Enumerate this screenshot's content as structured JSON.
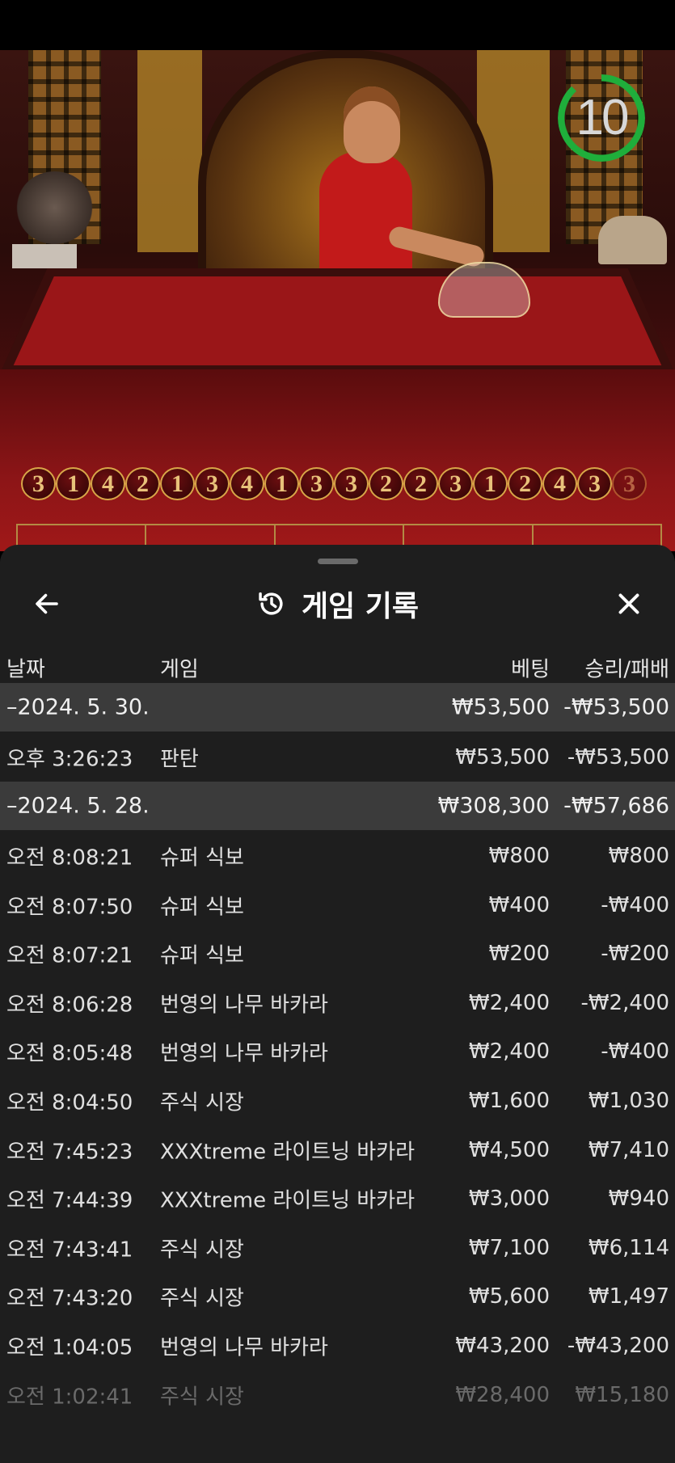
{
  "live": {
    "countdown": "10",
    "roadmap": [
      "3",
      "1",
      "4",
      "2",
      "1",
      "3",
      "4",
      "1",
      "3",
      "3",
      "2",
      "2",
      "3",
      "1",
      "2",
      "4",
      "3",
      "3"
    ]
  },
  "history_sheet": {
    "title": "게임 기록",
    "icons": {
      "back": "arrow-left-icon",
      "title": "history-icon",
      "close": "close-icon"
    },
    "columns": {
      "date": "날짜",
      "game": "게임",
      "bet": "베팅",
      "win_loss": "승리/패배"
    },
    "groups": [
      {
        "date": "–2024. 5. 30.",
        "bet_total": "₩53,500",
        "win_loss_total": "-₩53,500",
        "records": [
          {
            "time": "오후 3:26:23",
            "game": "판탄",
            "bet": "₩53,500",
            "win_loss": "-₩53,500"
          }
        ]
      },
      {
        "date": "–2024. 5. 28.",
        "bet_total": "₩308,300",
        "win_loss_total": "-₩57,686",
        "records": [
          {
            "time": "오전 8:08:21",
            "game": "슈퍼 식보",
            "bet": "₩800",
            "win_loss": "₩800"
          },
          {
            "time": "오전 8:07:50",
            "game": "슈퍼 식보",
            "bet": "₩400",
            "win_loss": "-₩400"
          },
          {
            "time": "오전 8:07:21",
            "game": "슈퍼 식보",
            "bet": "₩200",
            "win_loss": "-₩200"
          },
          {
            "time": "오전 8:06:28",
            "game": "번영의 나무 바카라",
            "bet": "₩2,400",
            "win_loss": "-₩2,400"
          },
          {
            "time": "오전 8:05:48",
            "game": "번영의 나무 바카라",
            "bet": "₩2,400",
            "win_loss": "-₩400"
          },
          {
            "time": "오전 8:04:50",
            "game": "주식 시장",
            "bet": "₩1,600",
            "win_loss": "₩1,030"
          },
          {
            "time": "오전 7:45:23",
            "game": "XXXtreme 라이트닝 바카라",
            "bet": "₩4,500",
            "win_loss": "₩7,410"
          },
          {
            "time": "오전 7:44:39",
            "game": "XXXtreme 라이트닝 바카라",
            "bet": "₩3,000",
            "win_loss": "₩940"
          },
          {
            "time": "오전 7:43:41",
            "game": "주식 시장",
            "bet": "₩7,100",
            "win_loss": "₩6,114"
          },
          {
            "time": "오전 7:43:20",
            "game": "주식 시장",
            "bet": "₩5,600",
            "win_loss": "₩1,497"
          },
          {
            "time": "오전 1:04:05",
            "game": "번영의 나무 바카라",
            "bet": "₩43,200",
            "win_loss": "-₩43,200"
          },
          {
            "time": "오전 1:02:41",
            "game": "주식 시장",
            "bet": "₩28,400",
            "win_loss": "₩15,180"
          }
        ]
      }
    ]
  }
}
